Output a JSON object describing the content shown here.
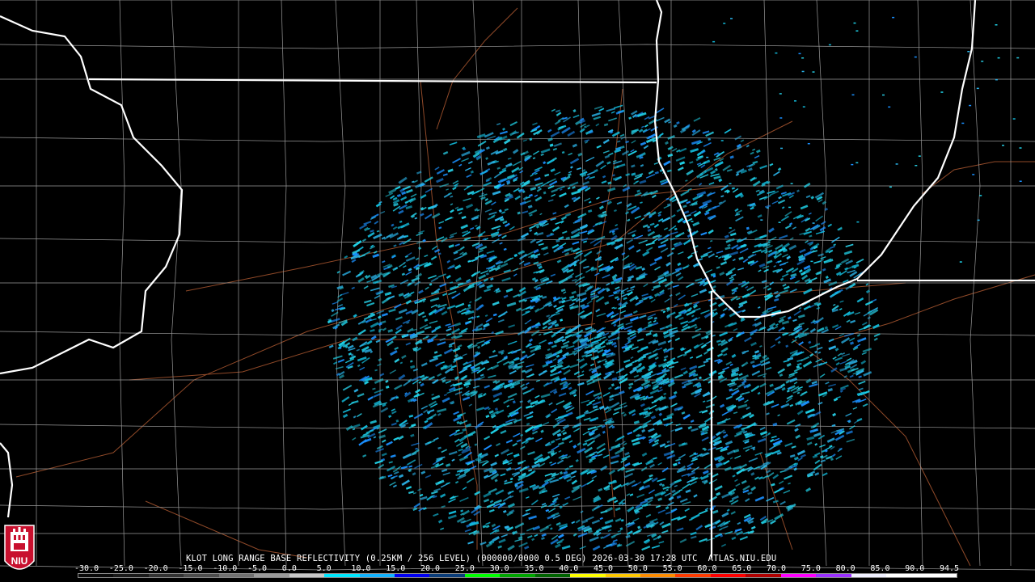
{
  "product": {
    "title": "KLOT LONG RANGE BASE REFLECTIVITY (0.25KM / 256 LEVEL) (000000/0000 0.5 DEG) 2026-03-30 17:28 UTC  ATLAS.NIU.EDU",
    "station": "KLOT",
    "time_utc": "2026-03-30 17:28 UTC",
    "elevation": "0.5 DEG",
    "source": "ATLAS.NIU.EDU"
  },
  "scale": {
    "labels": [
      "-30.0",
      "-25.0",
      "-20.0",
      "-15.0",
      "-10.0",
      "-5.0",
      "0.0",
      "5.0",
      "10.0",
      "15.0",
      "20.0",
      "25.0",
      "30.0",
      "35.0",
      "40.0",
      "45.0",
      "50.0",
      "55.0",
      "60.0",
      "65.0",
      "70.0",
      "75.0",
      "80.0",
      "85.0",
      "90.0",
      "94.5"
    ],
    "colors": [
      "#0a0a0a",
      "#1a1a1a",
      "#333333",
      "#4d4d4d",
      "#707070",
      "#9a9a9a",
      "#c8c8c8",
      "#00e8ff",
      "#12b3ff",
      "#0000f0",
      "#0a3d7a",
      "#00ff00",
      "#00a600",
      "#006400",
      "#ffff00",
      "#ffc800",
      "#ff8c00",
      "#ff3b00",
      "#ff0000",
      "#b00000",
      "#ff00ff",
      "#9b30ff",
      "#f0f0ff",
      "#ffffff",
      "#ffffff"
    ]
  },
  "map": {
    "echo_colors": [
      "#1fd0e6",
      "#12b9d9",
      "#26c6dc",
      "#2ab4ea",
      "#1a90ff"
    ],
    "boundary_color": "#ffffff",
    "county_color": "#9a9a9a",
    "road_color": "#a0522d",
    "radar_site": "KLOT"
  },
  "logo": {
    "text": "NIU",
    "colors": {
      "primary": "#c8102e",
      "secondary": "#ffffff"
    }
  }
}
